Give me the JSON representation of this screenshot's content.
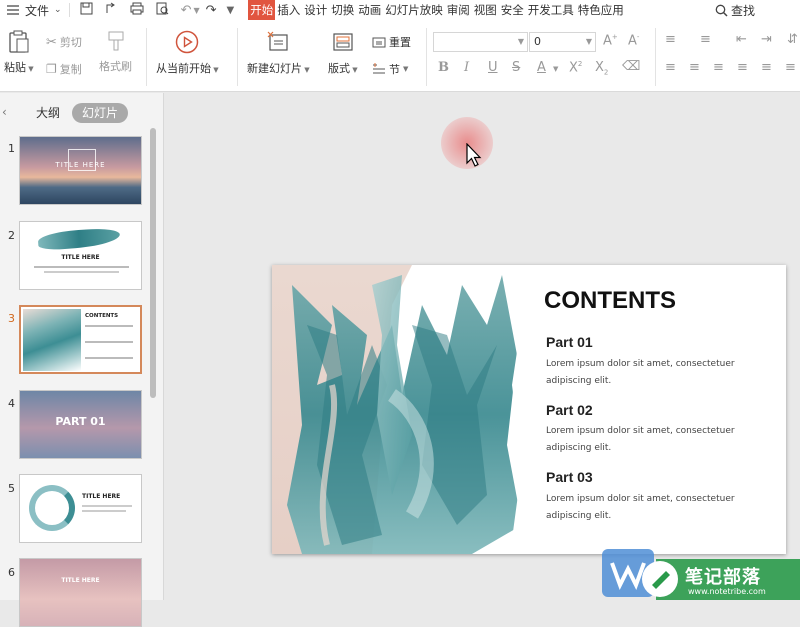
{
  "menubar": {
    "menu_icon": "hamburger-icon",
    "file_label": "文件",
    "tabs": [
      "开始",
      "插入",
      "设计",
      "切换",
      "动画",
      "幻灯片放映",
      "审阅",
      "视图",
      "安全",
      "开发工具",
      "特色应用"
    ],
    "active_tab": "开始",
    "search_label": "查找"
  },
  "ribbon": {
    "paste_label": "粘贴",
    "cut_label": "剪切",
    "copy_label": "复制",
    "format_painter_label": "格式刷",
    "play_from_current_label": "从当前开始",
    "new_slide_label": "新建幻灯片",
    "layout_label": "版式",
    "reset_label": "重置",
    "section_label": "节",
    "font_name_value": "",
    "font_size_value": "0"
  },
  "panel": {
    "tab_outline": "大纲",
    "tab_slides": "幻灯片",
    "thumbs": [
      {
        "num": "1",
        "text": "TITLE HERE"
      },
      {
        "num": "2",
        "text": "TITLE HERE"
      },
      {
        "num": "3",
        "text": "CONTENTS"
      },
      {
        "num": "4",
        "text": "PART 01"
      },
      {
        "num": "5",
        "text": "TITLE HERE"
      },
      {
        "num": "6",
        "text": "TITLE HERE"
      }
    ],
    "selected": 3
  },
  "slide": {
    "title": "CONTENTS",
    "parts": [
      {
        "title": "Part 01",
        "desc": "Lorem ipsum dolor sit amet, consectetuer adipiscing elit."
      },
      {
        "title": "Part 02",
        "desc": "Lorem ipsum dolor sit amet, consectetuer adipiscing elit."
      },
      {
        "title": "Part 03",
        "desc": "Lorem ipsum dolor sit amet, consectetuer adipiscing elit."
      }
    ]
  },
  "watermark": {
    "brand": "笔记部落",
    "url": "www.notetribe.com"
  },
  "colors": {
    "accent": "#e1553f",
    "selected_border": "#d4885a",
    "teal": "#4a9ca0"
  }
}
